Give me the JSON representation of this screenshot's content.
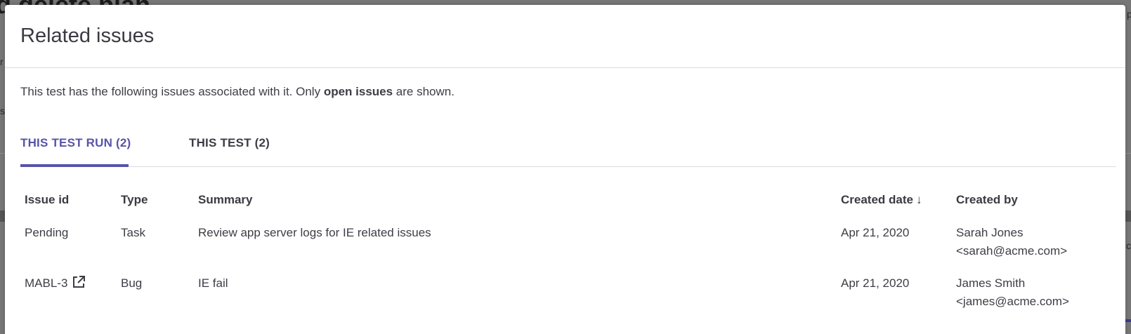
{
  "background": {
    "title_fragment": "d delete plan",
    "fragments": [
      "r",
      "s",
      "p",
      "c"
    ]
  },
  "modal": {
    "title": "Related issues",
    "intro_before": "This test has the following issues associated with it. Only ",
    "intro_bold": "open issues",
    "intro_after": " are shown."
  },
  "tabs": [
    {
      "label": "THIS TEST RUN (2)",
      "active": true
    },
    {
      "label": "THIS TEST (2)",
      "active": false
    }
  ],
  "table": {
    "headers": {
      "issue_id": "Issue id",
      "type": "Type",
      "summary": "Summary",
      "created_date": "Created date",
      "sort_indicator": "↓",
      "created_by": "Created by"
    },
    "rows": [
      {
        "issue_id": "Pending",
        "has_link": false,
        "type": "Task",
        "summary": "Review app server logs for IE related issues",
        "created_date": "Apr 21, 2020",
        "created_by_name": "Sarah Jones",
        "created_by_email": "<sarah@acme.com>"
      },
      {
        "issue_id": "MABL-3",
        "has_link": true,
        "type": "Bug",
        "summary": "IE fail",
        "created_date": "Apr 21, 2020",
        "created_by_name": "James Smith",
        "created_by_email": "<james@acme.com>"
      }
    ]
  },
  "colors": {
    "accent": "#5754a8",
    "text": "#3d3d45",
    "divider": "#dcdcdf",
    "backdrop": "#777777"
  },
  "icons": {
    "external_link": "external-link-icon",
    "sort": "arrow-down-icon"
  }
}
